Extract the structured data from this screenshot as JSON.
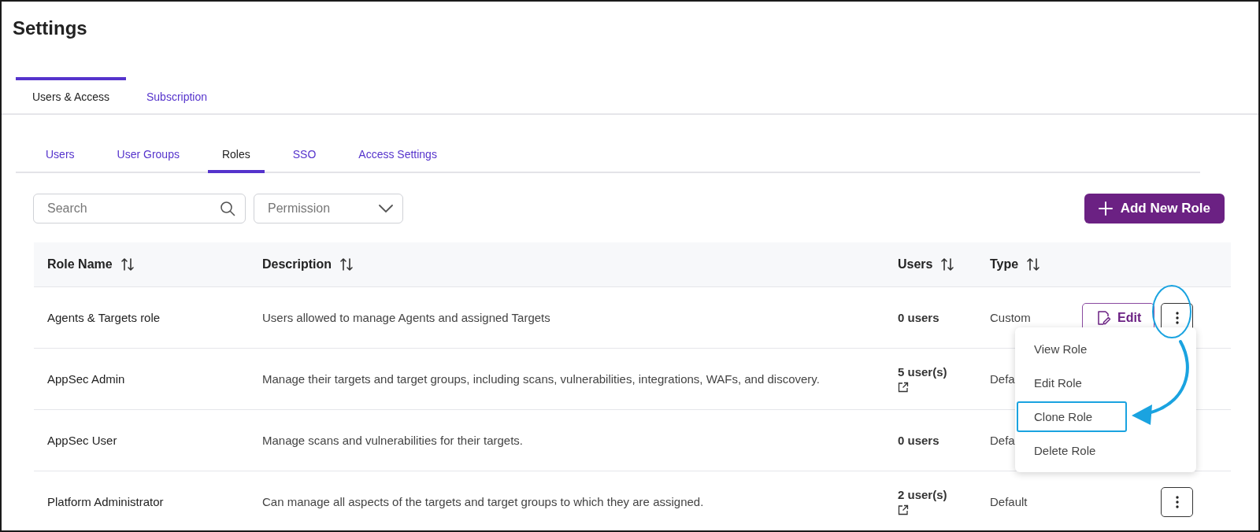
{
  "page_title": "Settings",
  "tabs": [
    {
      "label": "Users & Access",
      "selected": true
    },
    {
      "label": "Subscription",
      "selected": false
    }
  ],
  "subtabs": [
    {
      "label": "Users",
      "selected": false
    },
    {
      "label": "User Groups",
      "selected": false
    },
    {
      "label": "Roles",
      "selected": true
    },
    {
      "label": "SSO",
      "selected": false
    },
    {
      "label": "Access Settings",
      "selected": false
    }
  ],
  "search": {
    "placeholder": "Search"
  },
  "filter": {
    "placeholder": "Permission"
  },
  "add_button": "Add New Role",
  "table": {
    "columns": [
      "Role Name",
      "Description",
      "Users",
      "Type"
    ],
    "rows": [
      {
        "role_name": "Agents & Targets role",
        "description": "Users allowed to manage Agents and assigned Targets",
        "users": "0 users",
        "users_link": false,
        "type": "Custom",
        "edit": "Edit",
        "menu_button": true
      },
      {
        "role_name": "AppSec Admin",
        "description": "Manage their targets and target groups, including scans, vulnerabilities, integrations, WAFs, and discovery.",
        "users": "5 user(s)",
        "users_link": true,
        "type": "Defa",
        "menu_button": false
      },
      {
        "role_name": "AppSec User",
        "description": "Manage scans and vulnerabilities for their targets.",
        "users": "0 users",
        "users_link": false,
        "type": "Defa",
        "menu_button": false
      },
      {
        "role_name": "Platform Administrator",
        "description": "Can manage all aspects of the targets and target groups to which they are assigned.",
        "users": "2 user(s)",
        "users_link": true,
        "type": "Default",
        "menu_button": true
      }
    ]
  },
  "menu": {
    "items": [
      {
        "label": "View Role",
        "selected": false
      },
      {
        "label": "Edit Role",
        "selected": false
      },
      {
        "label": "Clone Role",
        "selected": true
      },
      {
        "label": "Delete Role",
        "selected": false
      }
    ]
  }
}
